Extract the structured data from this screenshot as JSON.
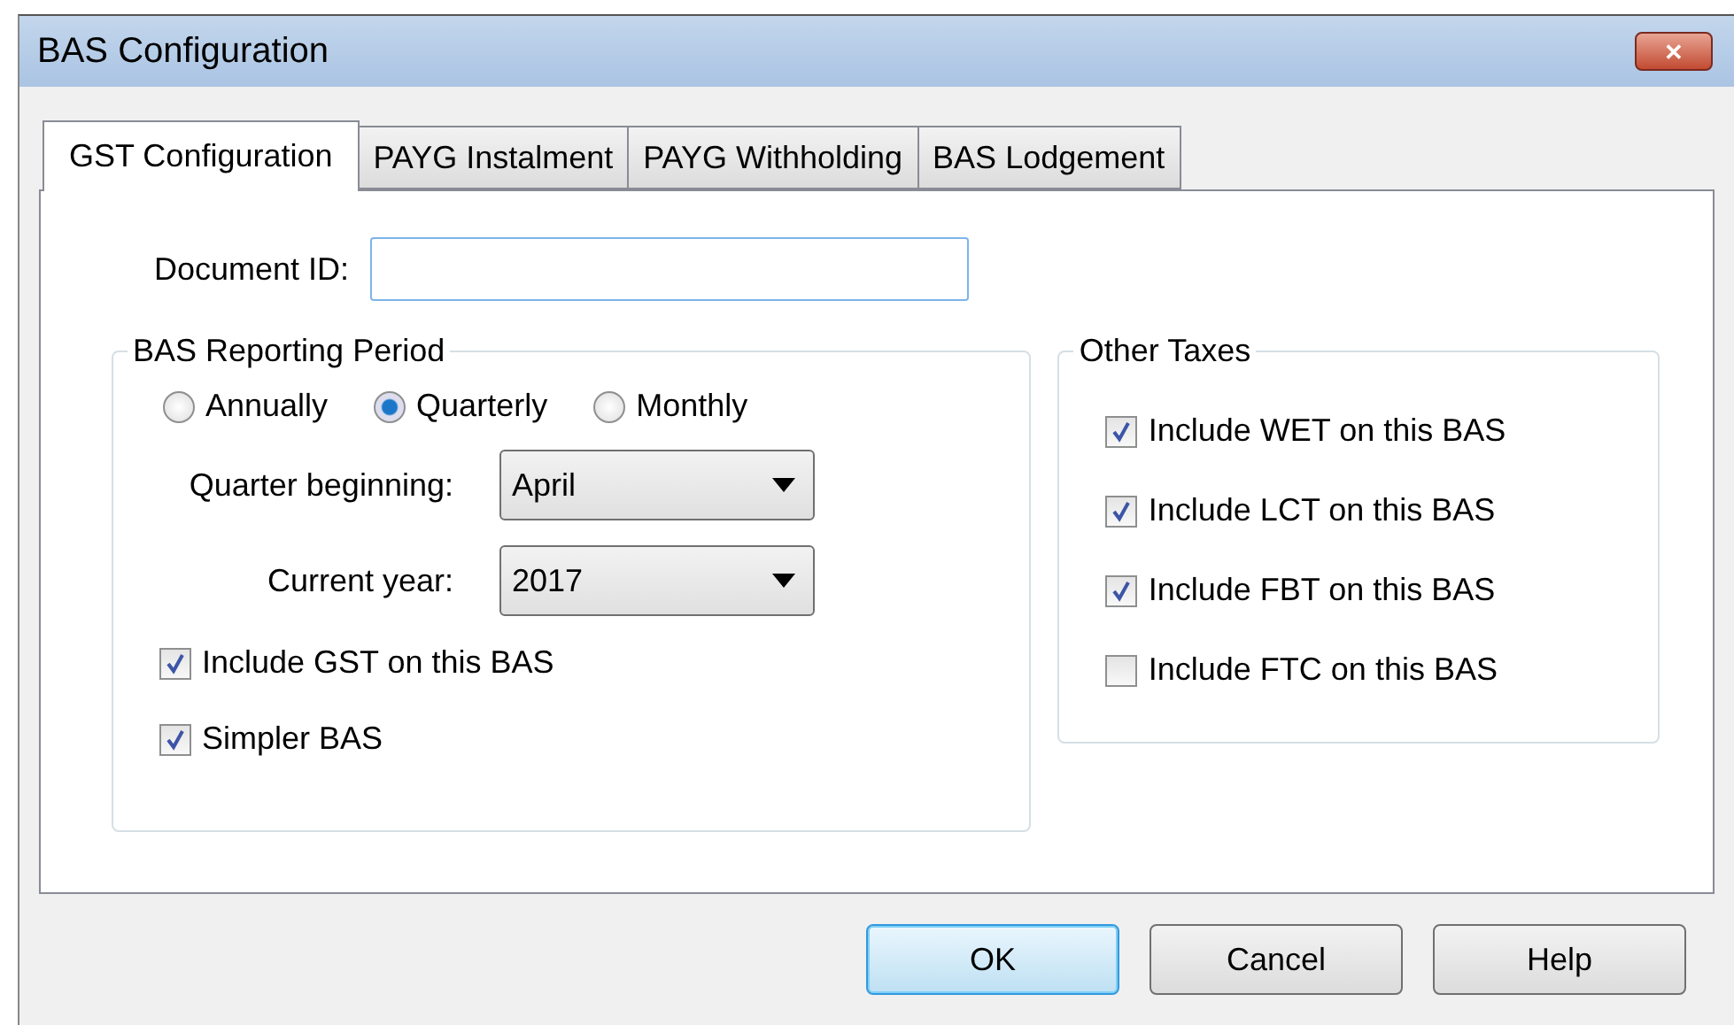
{
  "window": {
    "title": "BAS Configuration",
    "close": "✕"
  },
  "tabs": [
    {
      "label": "GST Configuration",
      "selected": true
    },
    {
      "label": "PAYG Instalment",
      "selected": false
    },
    {
      "label": "PAYG Withholding",
      "selected": false
    },
    {
      "label": "BAS Lodgement",
      "selected": false
    }
  ],
  "document_id": {
    "label": "Document ID:"
  },
  "reporting_period": {
    "title": "BAS Reporting Period",
    "options": [
      {
        "label": "Annually",
        "selected": false
      },
      {
        "label": "Quarterly",
        "selected": true
      },
      {
        "label": "Monthly",
        "selected": false
      }
    ],
    "dropdowns": [
      {
        "label": "Quarter beginning:",
        "value": "April"
      },
      {
        "label": "Current year:",
        "value": "2017"
      }
    ],
    "checkboxes": [
      {
        "label": "Include GST on this BAS",
        "checked": true
      },
      {
        "label": "Simpler BAS",
        "checked": true
      }
    ]
  },
  "other_taxes": {
    "title": "Other Taxes",
    "checkboxes": [
      {
        "label": "Include WET on this BAS",
        "checked": true
      },
      {
        "label": "Include LCT on this BAS",
        "checked": true
      },
      {
        "label": "Include FBT on this BAS",
        "checked": true
      },
      {
        "label": "Include FTC on this BAS",
        "checked": false
      }
    ]
  },
  "buttons": [
    {
      "label": "OK",
      "default": true
    },
    {
      "label": "Cancel",
      "default": false
    },
    {
      "label": "Help",
      "default": false
    }
  ]
}
